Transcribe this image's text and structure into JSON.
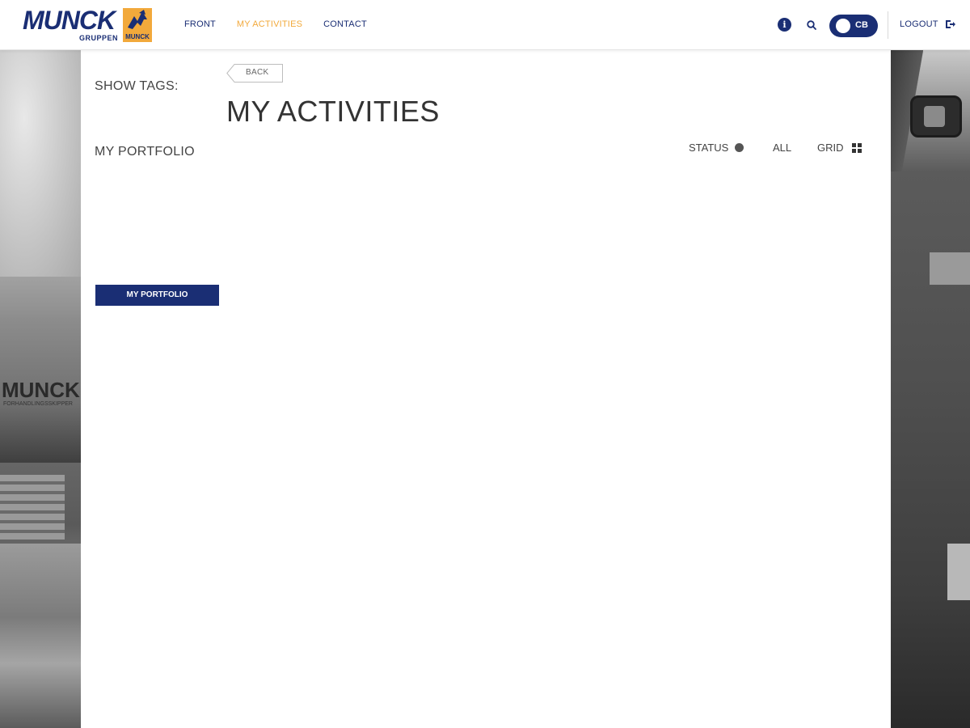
{
  "header": {
    "logo": {
      "word": "MUNCK",
      "sub": "GRUPPEN",
      "mark_text": "MUNCK"
    },
    "nav": [
      {
        "label": "FRONT",
        "active": false
      },
      {
        "label": "MY ACTIVITIES",
        "active": true
      },
      {
        "label": "CONTACT",
        "active": false
      }
    ],
    "icons": [
      "info-icon",
      "search-icon"
    ],
    "toggle_label": "CB",
    "logout_label": "LOGOUT"
  },
  "sidebar": {
    "show_tags_label": "SHOW TAGS:",
    "portfolio_title": "MY PORTFOLIO",
    "portfolio_button": "MY PORTFOLIO"
  },
  "main": {
    "back_label": "BACK",
    "title": "MY ACTIVITIES",
    "filters": {
      "status_label": "STATUS",
      "all_label": "ALL",
      "grid_label": "GRID"
    }
  },
  "background": {
    "machine_text": "MUNCK",
    "machine_sub": "FORHANDLINGSSKIPPER"
  },
  "colors": {
    "brand_navy": "#1a2e74",
    "brand_orange": "#f2a93b",
    "text_dark": "#333333"
  }
}
